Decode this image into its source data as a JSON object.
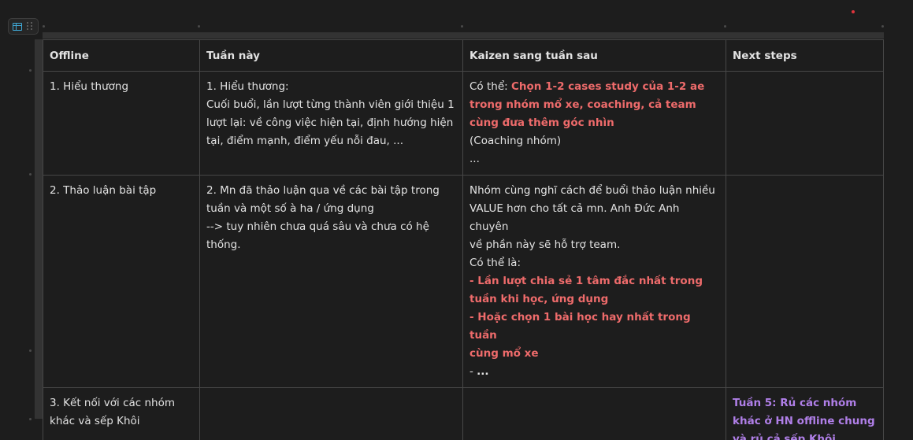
{
  "table": {
    "headers": [
      "Offline",
      "Tuần này",
      "Kaizen sang tuần sau",
      "Next steps"
    ],
    "rows": [
      {
        "offline": "1. Hiểu thương",
        "this_week": {
          "l1": "1. Hiểu thương:",
          "l2": "Cuối buổi, lần lượt từng thành viên giới thiệu 1",
          "l3": "lượt lại: về công việc hiện tại, định hướng hiện",
          "l4": "tại, điểm mạnh, điểm yếu nỗi đau, ..."
        },
        "kaizen": {
          "l1_prefix": "Có thể: ",
          "l1_red": "Chọn 1-2 cases study của 1-2 ae",
          "l2_red": "trong nhóm mổ xe, coaching, cả team",
          "l3_red": "cùng đưa thêm góc nhìn",
          "l4": "(Coaching nhóm)",
          "l5": "..."
        },
        "next_steps": ""
      },
      {
        "offline": "2. Thảo luận bài tập",
        "this_week": {
          "l1": "2. Mn đã thảo luận qua về các bài tập trong",
          "l2": "tuần và một số à ha / ứng dụng",
          "l3": "--> tuy nhiên chưa quá sâu và chưa có hệ",
          "l4": "thống."
        },
        "kaizen": {
          "l1": "Nhóm cùng nghĩ cách để buổi thảo luận nhiều",
          "l2": "VALUE hơn cho tất cả mn. Anh Đức Anh chuyên",
          "l3": "về phần này sẽ hỗ trợ team.",
          "l4": "Có thể là:",
          "l5_red": "- Lần lượt chia sẻ 1 tâm đắc nhất trong",
          "l6_red": "tuần khi học, ứng dụng",
          "l7_red": "- Hoặc chọn 1 bài học hay nhất trong tuần",
          "l8_red": "cùng mổ xe",
          "l9_prefix": "- ",
          "l9_bold": "..."
        },
        "next_steps": ""
      },
      {
        "offline": {
          "l1": "3. Kết nối với các nhóm",
          "l2": "khác và sếp Khôi"
        },
        "this_week": "",
        "kaizen": "",
        "next_steps": {
          "l1_purple": "Tuần 5: Rủ các nhóm",
          "l2_purple": "khác ở HN offline chung",
          "l3_purple": "và rủ cả sếp Khôi"
        }
      }
    ]
  },
  "toolbar": {
    "table_icon": "table-icon",
    "grip_icon": "drag-handle-icon"
  },
  "colors": {
    "background": "#1d1d1d",
    "border": "#474747",
    "highlight_red": "#ee6b6b",
    "highlight_purple": "#b07fe8",
    "toolbar_icon": "#3fa9d6",
    "indicator_dot": "#e0343c"
  }
}
